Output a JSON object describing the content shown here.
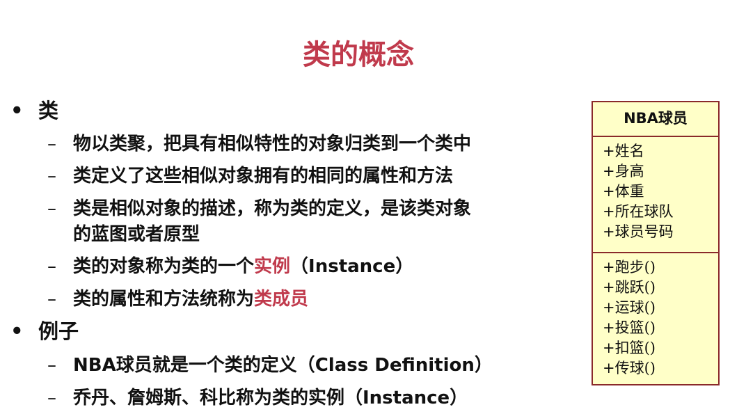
{
  "title": "类的概念",
  "bullets": [
    {
      "label": "类",
      "items": [
        {
          "text": "物以类聚，把具有相似特性的对象归类到一个类中"
        },
        {
          "text": "类定义了这些相似对象拥有的相同的属性和方法"
        },
        {
          "text": "类是相似对象的描述，称为类的定义，是该类对象",
          "cont": "的蓝图或者原型"
        },
        {
          "text": "类的对象称为类的一个",
          "hl": "实例",
          "after": "（Instance）"
        },
        {
          "text": "类的属性和方法统称为",
          "hl": "类成员"
        }
      ]
    },
    {
      "label": "例子",
      "items": [
        {
          "text": "NBA球员就是一个类的定义（Class Definition）"
        },
        {
          "text": "乔丹、詹姆斯、科比称为类的实例（Instance）"
        }
      ]
    }
  ],
  "uml": {
    "name": "NBA球员",
    "attributes": [
      "+姓名",
      "+身高",
      "+体重",
      "+所在球队",
      "+球员号码"
    ],
    "methods": [
      "+跑步()",
      "+跳跃()",
      "+运球()",
      "+投篮()",
      "+扣篮()",
      "+传球()"
    ]
  },
  "colors": {
    "accent": "#c03a4c",
    "uml_fill": "#ffffc8",
    "uml_border": "#8a2a2a"
  }
}
